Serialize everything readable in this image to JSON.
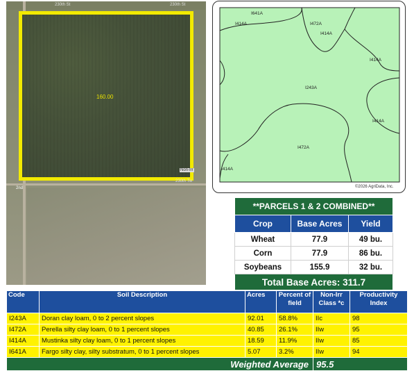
{
  "aerial": {
    "acres_label": "160.00",
    "tag_road_top": "230th St",
    "tag_corner": "Non-Irr",
    "tag_road_left": "2nd",
    "tag_road_br": "230th Tw",
    "border_color": "#f2ea00"
  },
  "soil_map": {
    "labels": [
      "I641A",
      "I414A",
      "I472A",
      "I414A",
      "I414A",
      "I243A",
      "I414A",
      "I472A",
      "I414A"
    ],
    "copyright": "©2026 AgriData, Inc.",
    "fill_color": "#b8f2b8"
  },
  "parcels": {
    "banner": "**PARCELS 1 & 2 COMBINED**",
    "headers": [
      "Crop",
      "Base Acres",
      "Yield"
    ],
    "rows": [
      {
        "crop": "Wheat",
        "acres": "77.9",
        "yield": "49 bu."
      },
      {
        "crop": "Corn",
        "acres": "77.9",
        "yield": "86 bu."
      },
      {
        "crop": "Soybeans",
        "acres": "155.9",
        "yield": "32 bu."
      }
    ],
    "total": "Total Base Acres:  311.7"
  },
  "soils": {
    "headers": {
      "code": "Code",
      "desc": "Soil Description",
      "acres": "Acres",
      "pct": "Percent of field",
      "class": "Non-Irr Class *c",
      "pi": "Productivity Index"
    },
    "rows": [
      {
        "code": "I243A",
        "desc": "Doran clay loam, 0 to 2 percent slopes",
        "acres": "92.01",
        "pct": "58.8%",
        "class": "IIc",
        "pi": "98"
      },
      {
        "code": "I472A",
        "desc": "Perella silty clay loam, 0 to 1 percent slopes",
        "acres": "40.85",
        "pct": "26.1%",
        "class": "IIw",
        "pi": "95"
      },
      {
        "code": "I414A",
        "desc": "Mustinka silty clay loam, 0 to 1 percent slopes",
        "acres": "18.59",
        "pct": "11.9%",
        "class": "IIw",
        "pi": "85"
      },
      {
        "code": "I641A",
        "desc": "Fargo silty clay, silty substratum, 0 to 1 percent slopes",
        "acres": "5.07",
        "pct": "3.2%",
        "class": "IIw",
        "pi": "94"
      }
    ],
    "weighted_label": "Weighted Average",
    "weighted_value": "95.5",
    "header_color": "#1e4f9e",
    "row_color": "#fff200",
    "banner_color": "#1f6b3a"
  }
}
